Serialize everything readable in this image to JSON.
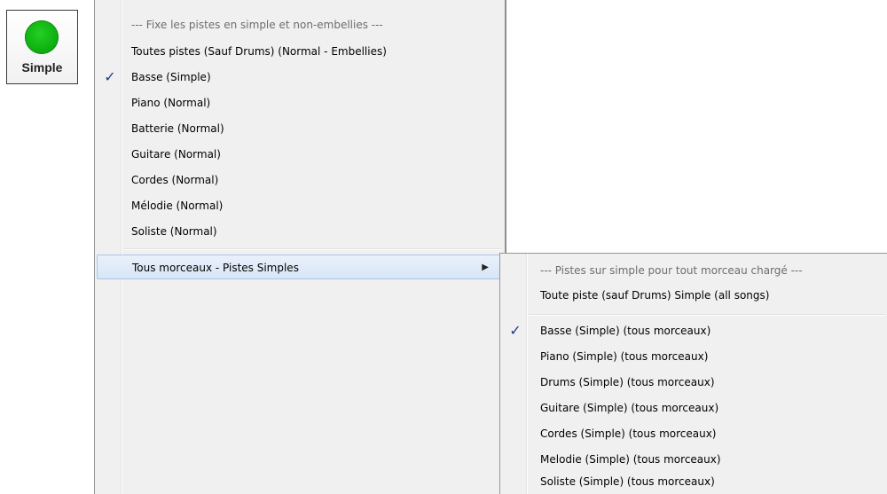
{
  "simple_button": {
    "label": "Simple",
    "icon": "green-circle-icon",
    "color": "#12b312"
  },
  "menu": {
    "items": [
      {
        "label": "--- Fixe les pistes en simple et non-embellies ---",
        "header": true
      },
      {
        "label": "Toutes pistes (Sauf Drums) (Normal - Embellies)"
      },
      {
        "label": "Basse (Simple)",
        "checked": true,
        "check": "✓"
      },
      {
        "label": "Piano (Normal)"
      },
      {
        "label": "Batterie (Normal)"
      },
      {
        "label": "Guitare (Normal)"
      },
      {
        "label": "Cordes (Normal)"
      },
      {
        "label": "Mélodie (Normal)"
      },
      {
        "label": "Soliste (Normal)"
      },
      {
        "label": "Tous morceaux - Pistes Simples",
        "highlighted": true,
        "submenu_arrow": "▶"
      }
    ]
  },
  "submenu": {
    "items": [
      {
        "label": "--- Pistes sur simple pour tout morceau chargé ---",
        "header": true
      },
      {
        "label": "Toute piste (sauf Drums) Simple (all songs)"
      },
      {
        "label": "Basse (Simple) (tous morceaux)",
        "checked": true,
        "check": "✓"
      },
      {
        "label": "Piano (Simple) (tous morceaux)"
      },
      {
        "label": "Drums (Simple) (tous morceaux)"
      },
      {
        "label": "Guitare (Simple) (tous morceaux)"
      },
      {
        "label": "Cordes (Simple) (tous morceaux)"
      },
      {
        "label": "Melodie (Simple) (tous morceaux)"
      },
      {
        "label": "Soliste (Simple) (tous morceaux)"
      }
    ]
  }
}
